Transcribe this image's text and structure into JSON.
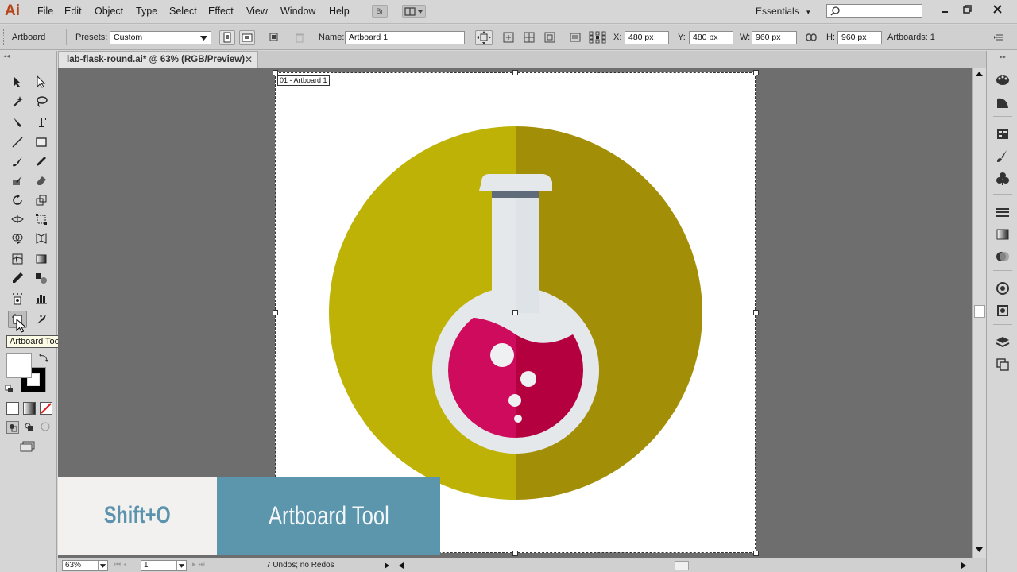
{
  "app": {
    "logo": "Ai"
  },
  "menu": [
    "File",
    "Edit",
    "Object",
    "Type",
    "Select",
    "Effect",
    "View",
    "Window",
    "Help"
  ],
  "menubar": {
    "bridge_label": "Br",
    "workspace": "Essentials",
    "workspace_arrow": "▾"
  },
  "control_bar": {
    "tool_name": "Artboard",
    "presets_label": "Presets:",
    "presets_value": "Custom",
    "name_label": "Name:",
    "name_value": "Artboard 1",
    "x_label": "X:",
    "x_value": "480 px",
    "y_label": "Y:",
    "y_value": "480 px",
    "w_label": "W:",
    "w_value": "960 px",
    "h_label": "H:",
    "h_value": "960 px",
    "artboards_label": "Artboards: 1"
  },
  "document": {
    "tab_title": "lab-flask-round.ai* @ 63% (RGB/Preview)",
    "tab_close": "✕",
    "artboard_label": "01 - Artboard 1"
  },
  "tooltip": "Artboard Tool (Shift+O)",
  "status_bar": {
    "zoom": "63%",
    "artboard_number": "1",
    "status_text": "7 Undos; no Redos"
  },
  "caption": {
    "shortcut": "Shift+O",
    "tool_name": "Artboard Tool"
  },
  "colors": {
    "circle_left": "#bfb206",
    "circle_right": "#a38f07",
    "flask_light": "#e4e8eb",
    "flask_light_shade": "#dde3e6",
    "flask_cap_band": "#5f6b78",
    "liquid_left": "#cf0b5e",
    "liquid_right": "#b5003f",
    "caption_key_bg": "#f2f1f0",
    "caption_tool_bg": "#5b96ad"
  }
}
